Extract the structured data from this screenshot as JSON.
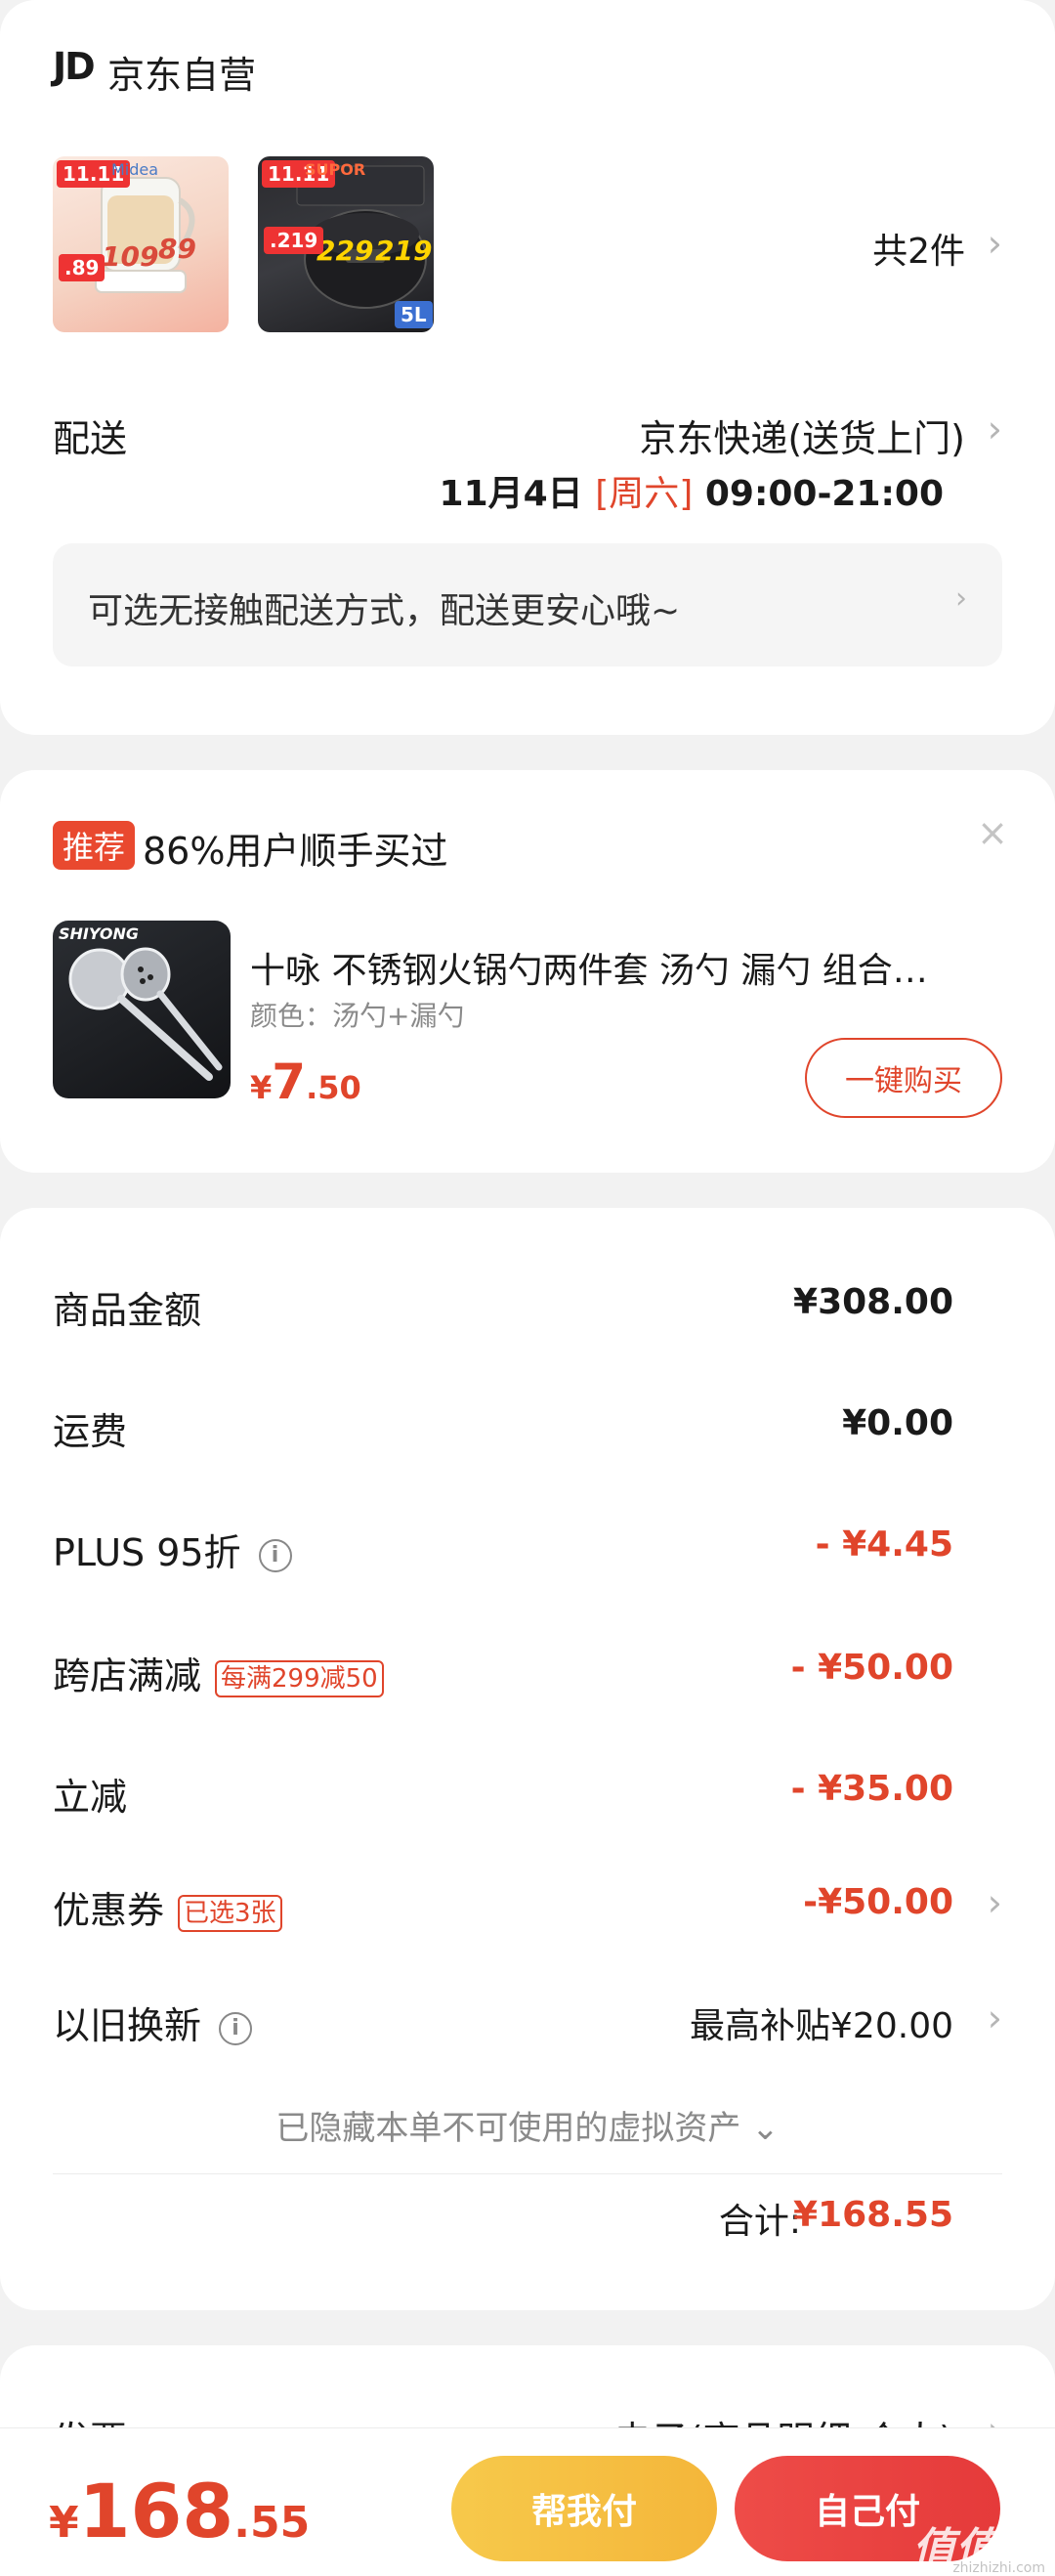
{
  "store": {
    "logo": "JD",
    "name": "京东自营",
    "count_text": "共2件",
    "products": [
      {
        "name": "kettle-product",
        "tags": [
          "11.11",
          "109",
          "89",
          ".89"
        ],
        "brand": "Midea"
      },
      {
        "name": "rice-cooker-product",
        "tags": [
          "11.11",
          "229",
          "219",
          ".219",
          "5L"
        ],
        "brand": "SUPOR"
      }
    ]
  },
  "delivery": {
    "label": "配送",
    "method": "京东快递(送货上门)",
    "date": "11月4日",
    "weekday": "[周六]",
    "time": "09:00-21:00",
    "contactless_text": "可选无接触配送方式，配送更安心哦~"
  },
  "recommend": {
    "badge": "推荐",
    "title": "86%用户顺手买过",
    "close": "×",
    "image_brand": "SHIYONG",
    "product_name": "十咏 不锈钢火锅勺两件套  汤勺 漏勺 组合…",
    "variant": "颜色：汤勺+漏勺",
    "price_symbol": "¥",
    "price_int": "7",
    "price_dec": ".50",
    "buy_label": "一键购买"
  },
  "summary": {
    "rows": [
      {
        "label": "商品金额",
        "value": "¥308.00"
      },
      {
        "label": "运费",
        "value": "¥0.00"
      },
      {
        "label": "PLUS 95折",
        "value": "- ¥4.45"
      },
      {
        "label": "跨店满减",
        "pill": "每满299减50",
        "value": "- ¥50.00"
      },
      {
        "label": "立减",
        "value": "- ¥35.00"
      },
      {
        "label": "优惠券",
        "pill": "已选3张",
        "value": "-¥50.00"
      },
      {
        "label": "以旧换新",
        "value": "最高补贴¥20.00"
      }
    ],
    "info_icon_text": "i",
    "hidden_assets": "已隐藏本单不可使用的虚拟资产 ⌄",
    "total_label": "合计:",
    "total_value": "¥168.55"
  },
  "invoice": {
    "label": "发票",
    "value": "电子(商品明细-个人)"
  },
  "bottom_bar": {
    "currency": "¥",
    "total_int": "168",
    "total_dec": ".55",
    "help_pay": "帮我付",
    "self_pay": "自己付"
  },
  "watermark": {
    "text": "值值值",
    "url": "zhizhizhi.com"
  },
  "colors": {
    "accent": "#e0452b",
    "help_button": "#f4b63a",
    "pay_button": "#e53a3a",
    "background": "#f2f2f2"
  }
}
